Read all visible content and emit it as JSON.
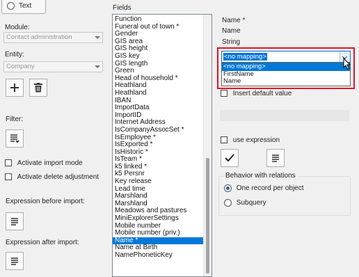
{
  "left": {
    "radio_text": "Text",
    "module_label": "Module:",
    "module_value": "Contact administration",
    "entity_label": "Entity:",
    "entity_value": "Company",
    "filter_label": "Filter:",
    "activate_import_mode": "Activate import mode",
    "activate_delete_adjustment": "Activate delete adjustment",
    "expression_before_import": "Expression before import:",
    "expression_after_import": "Expression after import:"
  },
  "fields": {
    "label": "Fields",
    "items": [
      "Function",
      "Funeral out of town *",
      "Gender",
      "GIS area",
      "GIS height",
      "GIS key",
      "GIS length",
      "Green",
      "Head of household *",
      "Heathland",
      "Heathland",
      "IBAN",
      "ImportData",
      "ImportID",
      "Internet Address",
      "IsCompanyAssocSet *",
      "IsEmployee *",
      "IsExported *",
      "IsHistoric *",
      "IsTeam *",
      "k5 linked *",
      "k5 Persnr",
      "Key release",
      "Lead time",
      "Marshland",
      "Marshland",
      "Meadows and pastures",
      "MiniExplorerSettings",
      "Mobile number",
      "Mobile number (priv.)",
      "Name *",
      "Name at Birth",
      "NamePhoneticKey"
    ],
    "selected": "Name *"
  },
  "right": {
    "name": "Name *",
    "caption": "Name",
    "type": "String",
    "mapping_value": "<no mapping>",
    "mapping_options": [
      "<no mapping>",
      "FirstName",
      "Name"
    ],
    "insert_default_value": "Insert default value",
    "use_expression": "use expression",
    "behavior_title": "Behavior with relations",
    "one_record": "One record per object",
    "subquery": "Subquery"
  },
  "colors": {
    "selection": "#0078d7",
    "highlight_border": "#e81123"
  }
}
